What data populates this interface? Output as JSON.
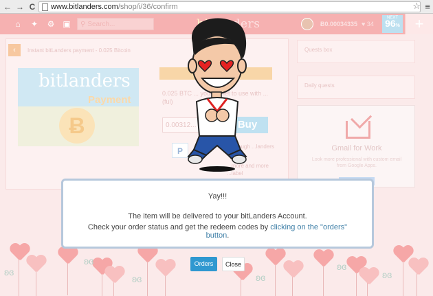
{
  "browser": {
    "url_host": "www.bitlanders.com",
    "url_path": "/shop/i/36/confirm",
    "back": "←",
    "forward": "→",
    "reload": "C",
    "star": "☆",
    "menu": "≡"
  },
  "header": {
    "search_placeholder": "Search...",
    "logo_bit": "bit",
    "logo_rest": "landers",
    "balance": "0.00034335",
    "badge_value": "34",
    "level_label": "NEXT",
    "level_value": "96",
    "level_suffix": "%",
    "plus": "+"
  },
  "page": {
    "breadcrumb": "Instant bitLanders payment - 0.025 Bitcoin",
    "card_title": "bitlanders",
    "card_subtitle": "Payment",
    "info_text": "0.025 BTC ... your wallet to use with ... (ful)",
    "amount": "0.00312...",
    "buy_label": "Buy",
    "paypal": "P",
    "through_text": "...through ...landers credit",
    "more_text": "...more and more ...label",
    "quests_box": "Quests box",
    "daily_quests": "Daily quests",
    "ad_title": "Gmail for Work",
    "ad_sub": "Look more professional with custom email from Google Apps."
  },
  "modal": {
    "title": "Yay!!!",
    "line1": "The item will be delivered to your bitLanders Account.",
    "line2_prefix": "Check your order status and get the redeem codes by ",
    "line2_link": "clicking on the \"orders\" button",
    "line2_suffix": ".",
    "orders_button": "Orders",
    "close_button": "Close"
  },
  "colors": {
    "header_pink": "#f6b1b1",
    "orders_blue": "#2f98d0",
    "modal_border": "#b6c8dc",
    "link_blue": "#3d7ea6"
  }
}
